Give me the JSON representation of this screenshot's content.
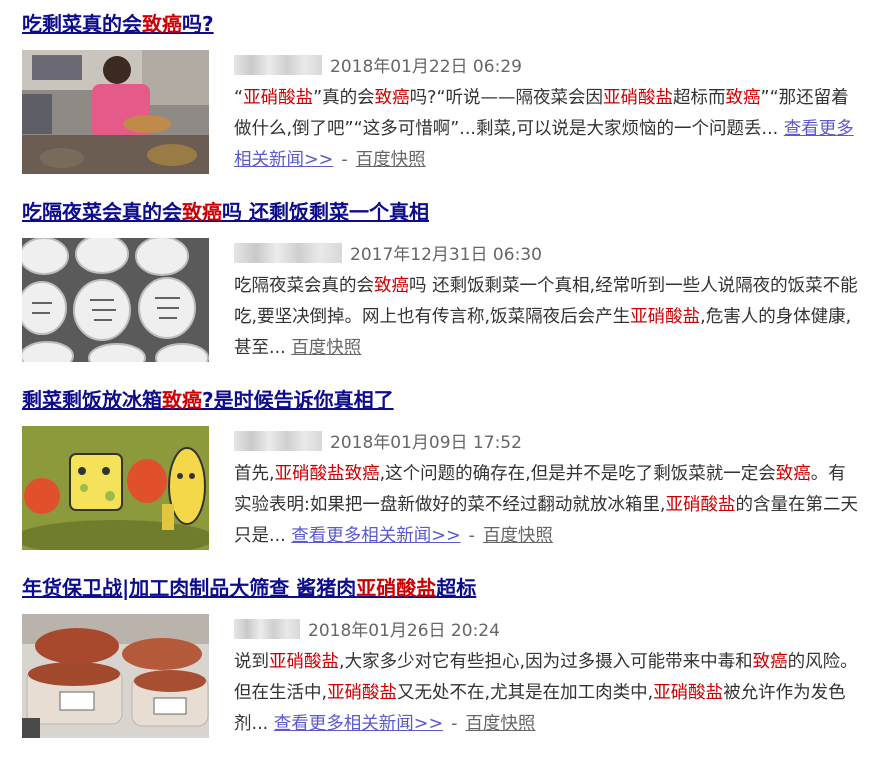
{
  "results": [
    {
      "title": [
        "吃剩菜真的会",
        "致癌",
        "吗?"
      ],
      "date": "2018年01月22日 06:29",
      "abstract": [
        "“",
        "亚硝酸盐",
        "”真的会",
        "致癌",
        "吗?“听说——隔夜菜会因",
        "亚硝酸盐",
        "超标而",
        "致",
        "癌",
        "”“那还留着做什么,倒了吧”“这多可惜啊”...剩菜,可以说是大家烦恼的一个问题丢..."
      ],
      "more_label": "查看更多相关新闻>>",
      "dash": "-",
      "snapshot_label": "百度快照"
    },
    {
      "title": [
        "吃隔夜菜会真的会",
        "致癌",
        "吗 还剩饭剩菜一个真相"
      ],
      "date": "2017年12月31日 06:30",
      "abstract": [
        "吃隔夜菜会真的会",
        "致癌",
        "吗 还剩饭剩菜一个真相,经常听到一些人说隔夜的饭菜不能吃,要坚决倒掉。网上也有传言称,饭菜隔夜后会产生",
        "亚",
        "硝酸盐",
        ",危害人的身体健康,甚至..."
      ],
      "snapshot_label": "百度快照"
    },
    {
      "title": [
        "剩菜剩饭放冰箱",
        "致癌",
        "?是时候告诉你真相了"
      ],
      "date": "2018年01月09日 17:52",
      "abstract": [
        "首先,",
        "亚硝酸盐致癌",
        ",这个问题的确存在,但是并不是吃了剩饭菜就一定会",
        "致癌",
        "。有实验表明:如果把一盘新做好的菜不经过翻动就放冰箱里,",
        "亚硝酸盐",
        "的含量在第二天只是..."
      ],
      "more_label": "查看更多相关新闻>>",
      "dash": "-",
      "snapshot_label": "百度快照"
    },
    {
      "title": [
        "年货保卫战|加工肉制品大筛查 酱猪肉",
        "亚硝酸盐",
        "超标"
      ],
      "date": "2018年01月26日 20:24",
      "abstract": [
        "说到",
        "亚硝酸盐",
        ",大家多少对它有些担心,因为过多摄入可能带来中毒和",
        "致癌",
        "的风险。但在生活中,",
        "亚硝酸盐",
        "又无处不在,尤其是在加工肉类中,",
        "亚硝酸盐",
        "被允许作为发色剂..."
      ],
      "more_label": "查看更多相关新闻>>",
      "dash": "-",
      "snapshot_label": "百度快照"
    }
  ],
  "colors": {
    "title": "#0c0c8c",
    "highlight": "#cc0000",
    "more_link": "#5a5acc",
    "meta": "#666666"
  }
}
